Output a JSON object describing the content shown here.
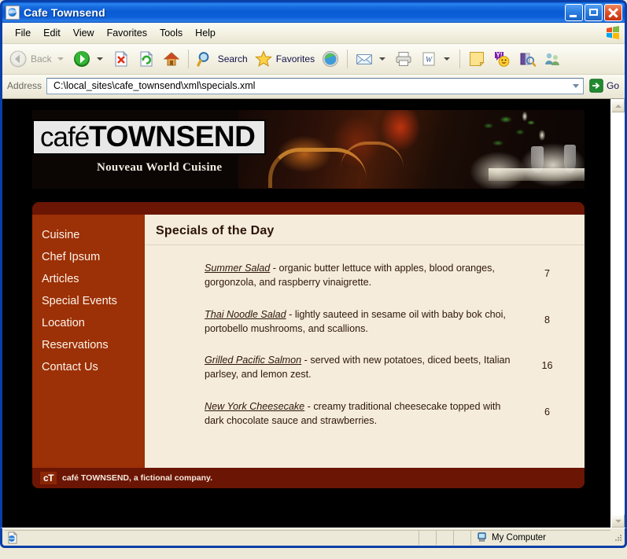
{
  "window": {
    "title": "Cafe Townsend",
    "icon": "ie-document-icon",
    "controls": {
      "minimize": "Minimize",
      "maximize": "Maximize",
      "close": "Close"
    }
  },
  "menubar": {
    "items": [
      "File",
      "Edit",
      "View",
      "Favorites",
      "Tools",
      "Help"
    ]
  },
  "toolbar": {
    "back_label": "Back",
    "search_label": "Search",
    "favorites_label": "Favorites",
    "icons": [
      "back-arrow-icon",
      "forward-arrow-icon",
      "stop-icon",
      "refresh-icon",
      "home-icon",
      "search-magnifier-icon",
      "favorites-star-icon",
      "media-icon",
      "mail-icon",
      "print-icon",
      "edit-word-icon",
      "notes-icon",
      "messenger-icon",
      "research-icon",
      "people-icon"
    ]
  },
  "address": {
    "label": "Address",
    "value": "C:\\local_sites\\cafe_townsend\\xml\\specials.xml",
    "go_label": "Go"
  },
  "site": {
    "logo": {
      "light": "café",
      "bold": "TOWNSEND"
    },
    "tagline": "Nouveau World Cuisine",
    "nav": [
      "Cuisine",
      "Chef Ipsum",
      "Articles",
      "Special Events",
      "Location",
      "Reservations",
      "Contact Us"
    ],
    "heading": "Specials of the Day",
    "specials": [
      {
        "name": "Summer Salad",
        "description": " - organic butter lettuce with apples, blood oranges, gorgonzola, and raspberry vinaigrette.",
        "price": "7"
      },
      {
        "name": "Thai Noodle Salad",
        "description": " - lightly sauteed in sesame oil with baby bok choi, portobello mushrooms, and scallions.",
        "price": "8"
      },
      {
        "name": "Grilled Pacific Salmon",
        "description": " - served with new potatoes, diced beets, Italian parlsey, and lemon zest.",
        "price": "16"
      },
      {
        "name": "New York Cheesecake",
        "description": " - creamy traditional cheesecake topped with dark chocolate sauce and strawberries.",
        "price": "6"
      }
    ],
    "footer": {
      "badge": "cT",
      "text": "café TOWNSEND, a fictional company."
    }
  },
  "statusbar": {
    "zone": "My Computer",
    "page_icon": "ie-page-icon",
    "zone_icon": "my-computer-icon"
  },
  "colors": {
    "titlebar_blue": "#0a5bd4",
    "frame_blue": "#0a3fa8",
    "chrome_beige": "#ece9d8",
    "site_dark": "#000000",
    "card_dark_red": "#6b1504",
    "nav_rust": "#9c3006",
    "content_cream": "#f5ecdc",
    "body_text": "#2e1708"
  }
}
